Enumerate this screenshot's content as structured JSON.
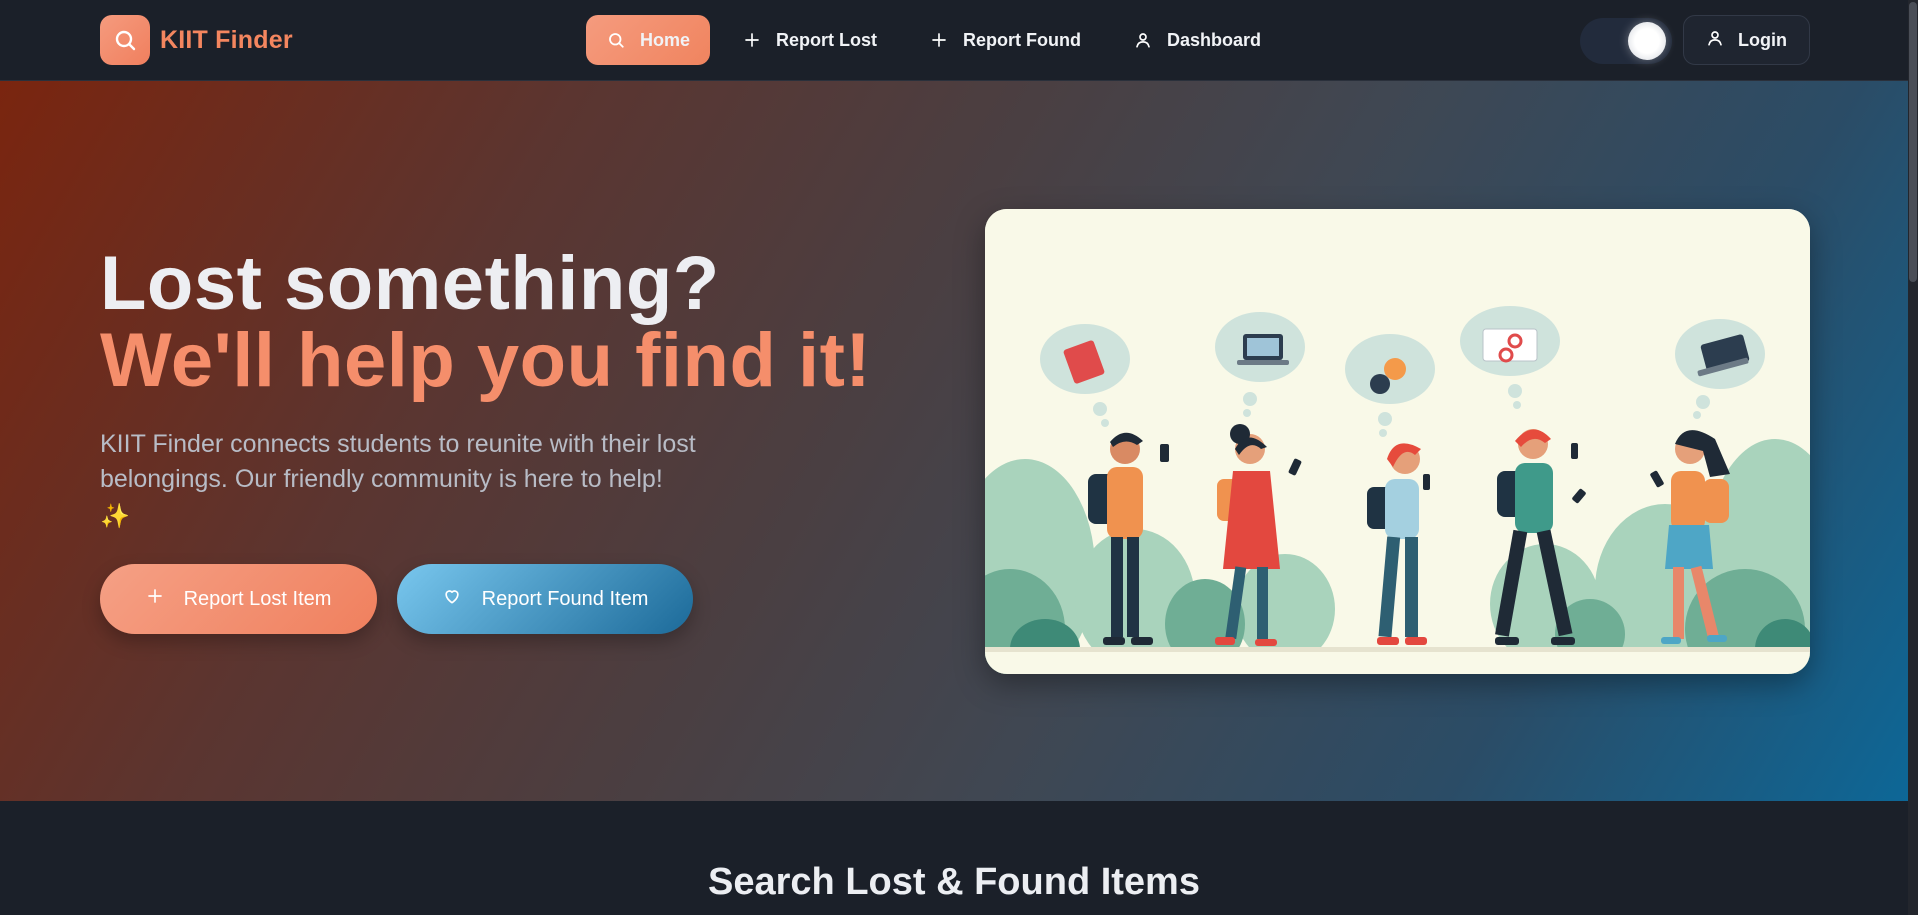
{
  "brand": {
    "name": "KIIT Finder",
    "icon": "search-icon"
  },
  "nav": {
    "items": [
      {
        "label": "Home",
        "icon": "search-icon",
        "active": true
      },
      {
        "label": "Report Lost",
        "icon": "plus-icon",
        "active": false
      },
      {
        "label": "Report Found",
        "icon": "plus-icon",
        "active": false
      },
      {
        "label": "Dashboard",
        "icon": "user-icon",
        "active": false
      }
    ],
    "login_label": "Login",
    "theme_toggle": "on"
  },
  "hero": {
    "title_line1": "Lost something?",
    "title_line2": "We'll help you find it!",
    "description": "KIIT Finder connects students to reunite with their lost belongings. Our friendly community is here to help!",
    "sparkle": "✨",
    "cta_lost": "Report Lost Item",
    "cta_found": "Report Found Item"
  },
  "search_section": {
    "title": "Search Lost & Found Items"
  },
  "colors": {
    "accent": "#f4865f",
    "blue": "#1c6a99",
    "nav_bg": "#1b2029"
  }
}
